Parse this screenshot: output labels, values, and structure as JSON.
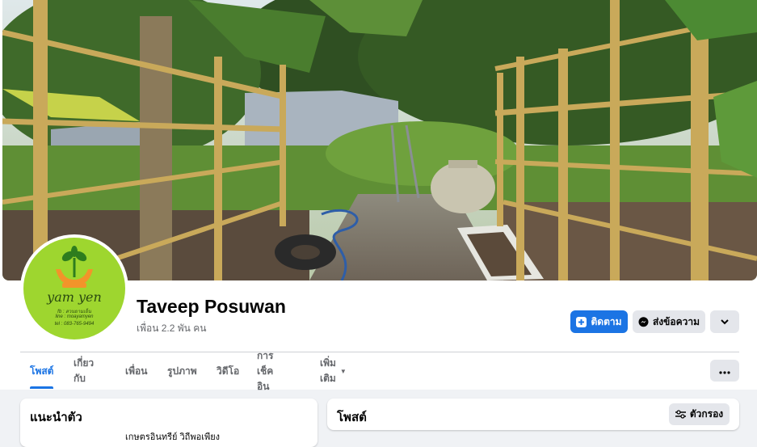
{
  "profile": {
    "name": "Taveep Posuwan",
    "friends_count": "เพื่อน 2.2 พัน คน"
  },
  "avatar": {
    "brand": "yam yen",
    "tagline1": "fb : สวนยามเย็น",
    "tagline2": "line : moayamyen",
    "tagline3": "tel : 083-765-9494"
  },
  "actions": {
    "follow_label": "ติดตาม",
    "message_label": "ส่งข้อความ"
  },
  "tabs": [
    {
      "label": "โพสต์",
      "active": true
    },
    {
      "label": "เกี่ยวกับ",
      "active": false
    },
    {
      "label": "เพื่อน",
      "active": false
    },
    {
      "label": "รูปภาพ",
      "active": false
    },
    {
      "label": "วิดีโอ",
      "active": false
    },
    {
      "label": "การเช็คอิน",
      "active": false
    },
    {
      "label": "เพิ่มเติม",
      "active": false
    }
  ],
  "intro": {
    "title": "แนะนำตัว",
    "first_line": "เกษตรอินทรีย์ วิถีพอเพียง"
  },
  "posts": {
    "title": "โพสต์",
    "filter_label": "ตัวกรอง"
  },
  "colors": {
    "accent": "#1b74e4",
    "avatar_bg": "#9ed62f"
  },
  "icons": {
    "follow": "follow-plus-icon",
    "message": "messenger-icon",
    "dropdown": "chevron-down-icon",
    "more": "more-horizontal-icon",
    "filter": "filter-sliders-icon"
  }
}
